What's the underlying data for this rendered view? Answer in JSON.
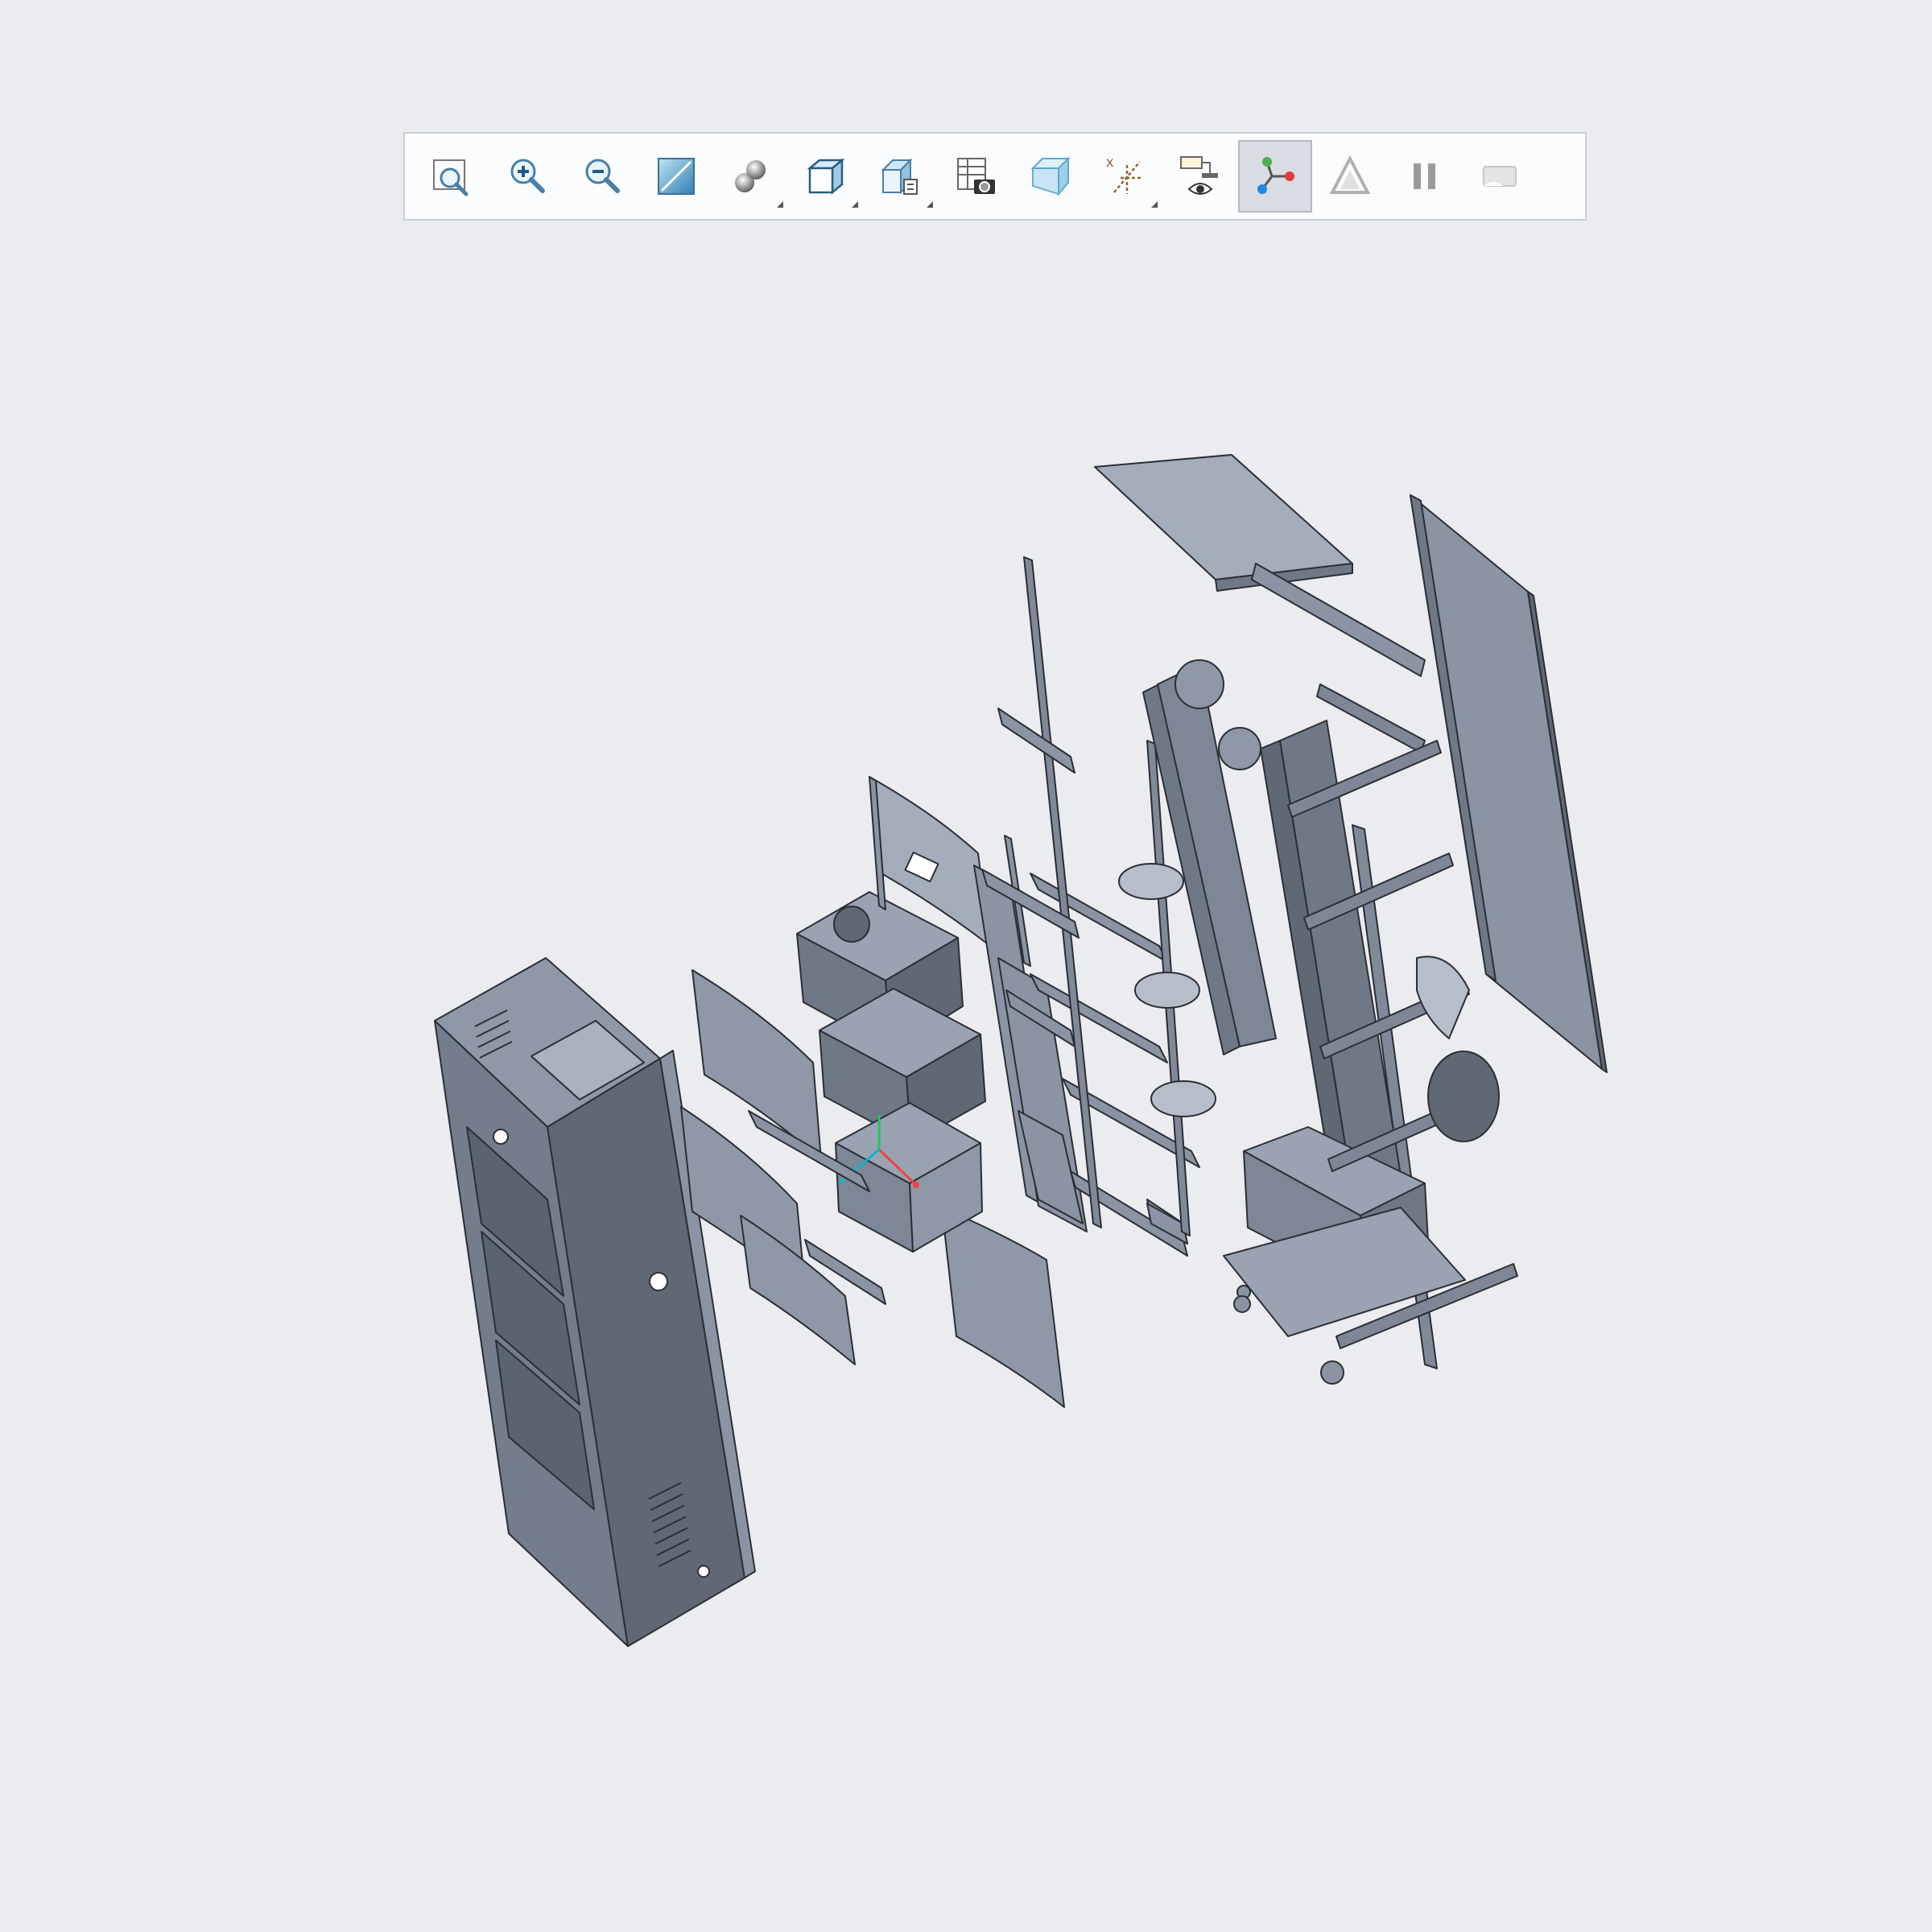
{
  "toolbar": {
    "buttons": [
      {
        "id": "refit",
        "icon": "refit-icon",
        "active": false,
        "flyout": false
      },
      {
        "id": "zoom-in",
        "icon": "zoom-in-icon",
        "active": false,
        "flyout": false
      },
      {
        "id": "zoom-out",
        "icon": "zoom-out-icon",
        "active": false,
        "flyout": false
      },
      {
        "id": "repaint",
        "icon": "repaint-icon",
        "active": false,
        "flyout": false
      },
      {
        "id": "display-style",
        "icon": "shaded-sphere-icon",
        "active": false,
        "flyout": true
      },
      {
        "id": "saved-views",
        "icon": "cube-view-icon",
        "active": false,
        "flyout": true
      },
      {
        "id": "named-views",
        "icon": "view-manager-icon",
        "active": false,
        "flyout": true
      },
      {
        "id": "appearance",
        "icon": "camera-table-icon",
        "active": false,
        "flyout": false
      },
      {
        "id": "section",
        "icon": "glass-cube-icon",
        "active": false,
        "flyout": false
      },
      {
        "id": "datum-display",
        "icon": "datum-display-icon",
        "active": false,
        "flyout": true
      },
      {
        "id": "annotation-display",
        "icon": "annotation-eye-icon",
        "active": false,
        "flyout": false
      },
      {
        "id": "spin-center",
        "icon": "spin-center-icon",
        "active": true,
        "flyout": false
      },
      {
        "id": "perspective",
        "icon": "perspective-icon",
        "active": false,
        "flyout": false
      },
      {
        "id": "pause",
        "icon": "pause-icon",
        "active": false,
        "flyout": false
      },
      {
        "id": "flat",
        "icon": "flat-toggle-icon",
        "active": false,
        "flyout": false
      }
    ]
  },
  "colors": {
    "background": "#eaecef",
    "part_light": "#aab3c1",
    "part_mid": "#8a94a2",
    "part_dark": "#5f6873",
    "edge": "#2b2f35"
  }
}
